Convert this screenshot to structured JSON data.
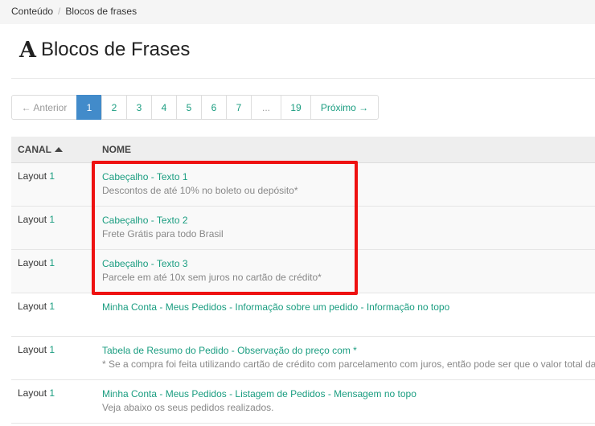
{
  "breadcrumb": {
    "items": [
      "Conteúdo",
      "Blocos de frases"
    ],
    "separator": "/"
  },
  "title": {
    "glyph": "A",
    "text": "Blocos de Frases"
  },
  "pagination": {
    "prev": "← Anterior",
    "pages": [
      "1",
      "2",
      "3",
      "4",
      "5",
      "6",
      "7"
    ],
    "ellipsis": "...",
    "last": "19",
    "next": "Próximo →",
    "active_page": "1"
  },
  "table": {
    "headers": {
      "canal": "CANAL",
      "nome": "NOME"
    },
    "rows": [
      {
        "layout": "Layout",
        "num": "1",
        "name": "Cabeçalho - Texto 1",
        "desc": "Descontos de até 10% no boleto ou depósito*"
      },
      {
        "layout": "Layout",
        "num": "1",
        "name": "Cabeçalho - Texto 2",
        "desc": "Frete Grátis para todo Brasil"
      },
      {
        "layout": "Layout",
        "num": "1",
        "name": "Cabeçalho - Texto 3",
        "desc": "Parcele em até 10x sem juros no cartão de crédito*"
      },
      {
        "layout": "Layout",
        "num": "1",
        "name": "Minha Conta - Meus Pedidos - Informação sobre um pedido - Informação no topo",
        "desc": ""
      },
      {
        "layout": "Layout",
        "num": "1",
        "name": "Tabela de Resumo do Pedido - Observação do preço com *",
        "desc": "* Se a compra foi feita utilizando cartão de crédito com parcelamento com juros, então pode ser que o valor total da"
      },
      {
        "layout": "Layout",
        "num": "1",
        "name": "Minha Conta - Meus Pedidos - Listagem de Pedidos - Mensagem no topo",
        "desc": "Veja abaixo os seus pedidos realizados."
      }
    ]
  },
  "colors": {
    "link": "#1a9d80",
    "active_page": "#428bca",
    "highlight": "#ee1111"
  }
}
